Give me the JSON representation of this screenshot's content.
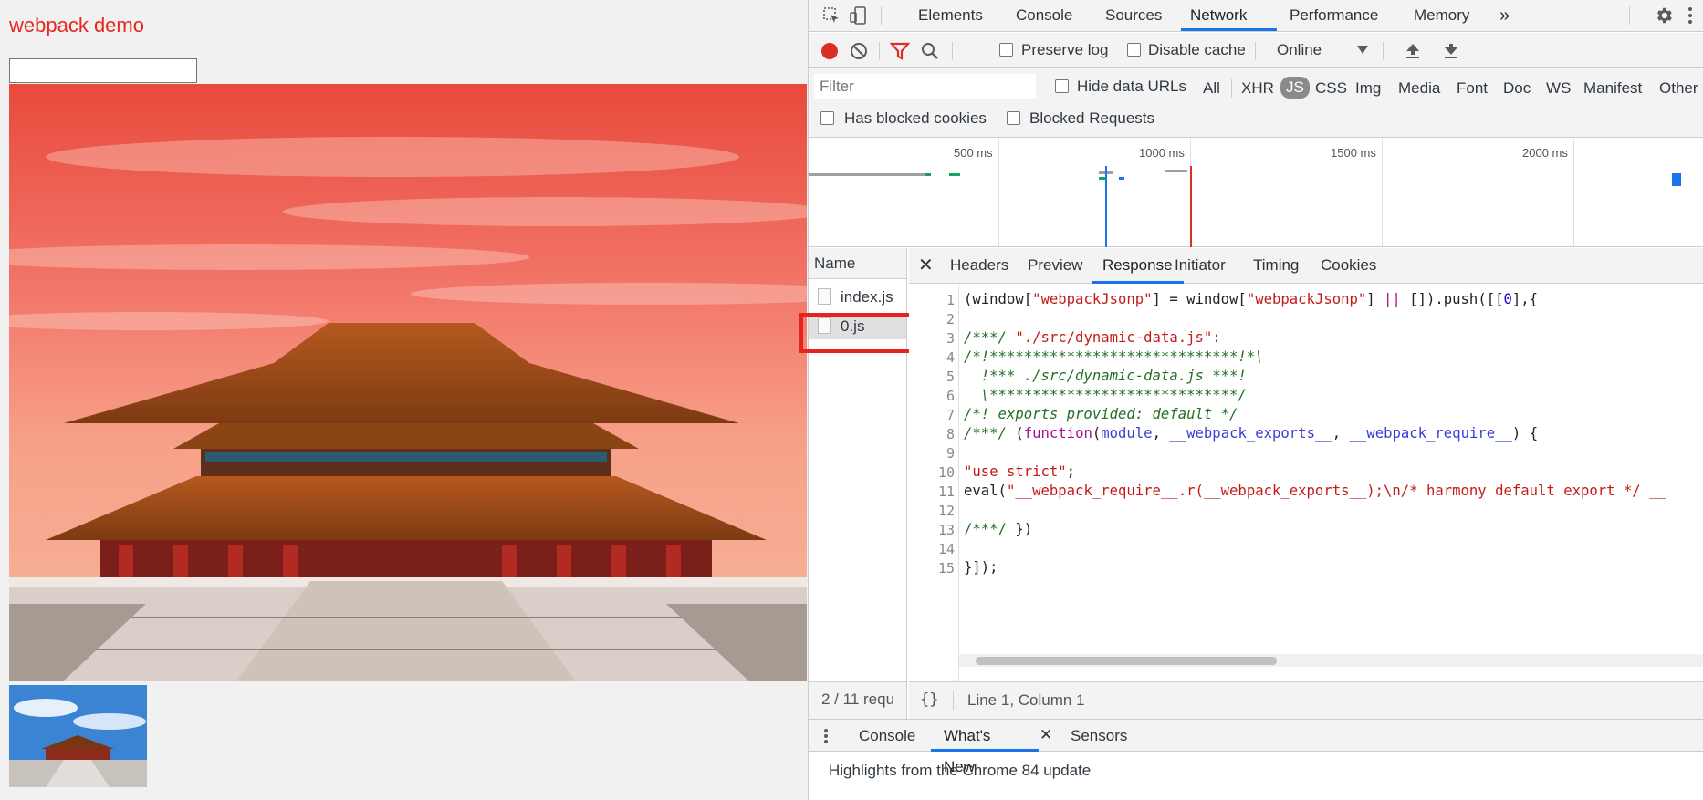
{
  "page": {
    "title": "webpack demo",
    "input_value": ""
  },
  "devtools": {
    "main_tabs": [
      "Elements",
      "Console",
      "Sources",
      "Network",
      "Performance",
      "Memory"
    ],
    "active_tab": "Network",
    "more_tabs_icon": "»",
    "network_toolbar": {
      "preserve_log": "Preserve log",
      "disable_cache": "Disable cache",
      "throttle": "Online"
    },
    "filter": {
      "placeholder": "Filter",
      "hide_data_urls": "Hide data URLs",
      "types": [
        "All",
        "XHR",
        "JS",
        "CSS",
        "Img",
        "Media",
        "Font",
        "Doc",
        "WS",
        "Manifest",
        "Other"
      ],
      "active_type": "JS",
      "has_blocked_cookies": "Has blocked cookies",
      "blocked_requests": "Blocked Requests"
    },
    "timeline": {
      "labels": [
        "500 ms",
        "1000 ms",
        "1500 ms",
        "2000 ms"
      ]
    },
    "requests": {
      "header": "Name",
      "items": [
        "index.js",
        "0.js"
      ],
      "status": "2 / 11 requ"
    },
    "detail_tabs": [
      "Headers",
      "Preview",
      "Response",
      "Initiator",
      "Timing",
      "Cookies"
    ],
    "active_detail_tab": "Response",
    "code_lines": [
      "1",
      "2",
      "3",
      "4",
      "5",
      "6",
      "7",
      "8",
      "9",
      "10",
      "11",
      "12",
      "13",
      "14",
      "15"
    ],
    "cursor_status": "Line 1, Column 1",
    "drawer": {
      "tabs": [
        "Console",
        "What's New",
        "Sensors"
      ],
      "active": "What's New",
      "message": "Highlights from the Chrome 84 update"
    }
  }
}
